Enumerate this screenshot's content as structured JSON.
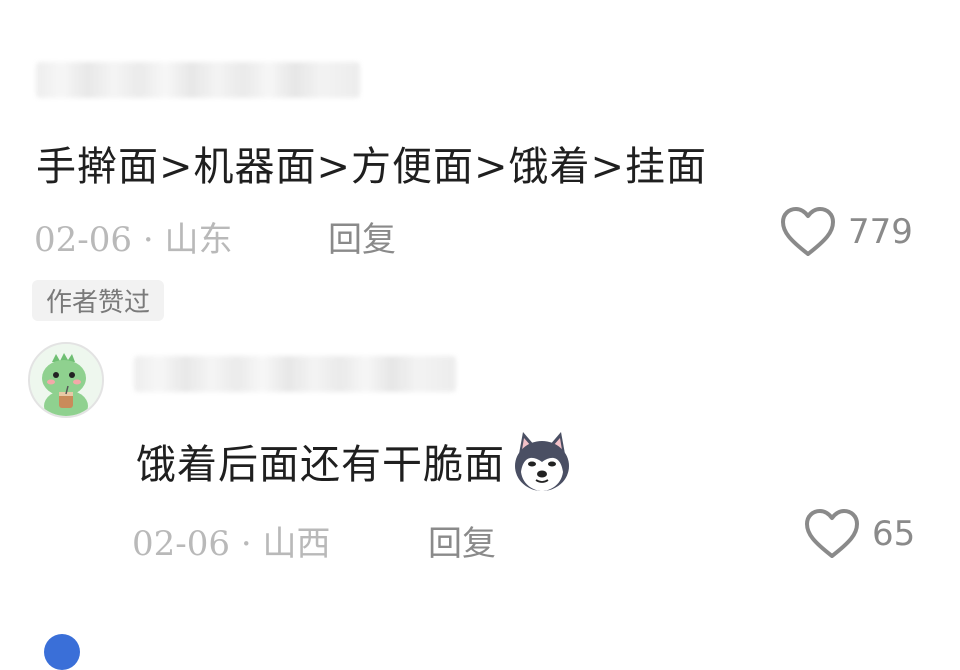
{
  "comments": [
    {
      "text": "手擀面>机器面>方便面>饿着>挂面",
      "date": "02-06",
      "location": "· 山东",
      "reply_label": "回复",
      "likes": "779",
      "badge": "作者赞过"
    },
    {
      "text": "饿着后面还有干脆面",
      "date": "02-06",
      "location": "· 山西",
      "reply_label": "回复",
      "likes": "65",
      "emoji": "husky-dog-emoji"
    }
  ],
  "icons": {
    "like": "heart-outline-icon",
    "avatar": "green-dinosaur-avatar"
  },
  "colors": {
    "text": "#1f1f1f",
    "meta": "#b9b9b9",
    "action": "#8a8a8a",
    "badge_bg": "#f2f2f2"
  }
}
